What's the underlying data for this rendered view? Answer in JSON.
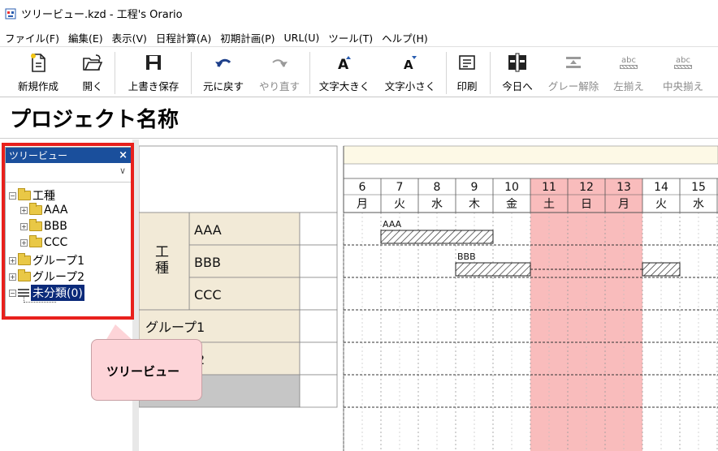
{
  "window": {
    "title": "ツリービュー.kzd - 工程's Orario"
  },
  "menu": [
    "ファイル(F)",
    "編集(E)",
    "表示(V)",
    "日程計算(A)",
    "初期計画(P)",
    "URL(U)",
    "ツール(T)",
    "ヘルプ(H)"
  ],
  "toolbar": {
    "new": "新規作成",
    "open": "開く",
    "save": "上書き保存",
    "undo": "元に戻す",
    "redo": "やり直す",
    "font_up": "文字大きく",
    "font_down": "文字小さく",
    "print": "印刷",
    "today": "今日へ",
    "gray_clear": "グレー解除",
    "align_left": "左揃え",
    "align_center": "中央揃え",
    "align_sample": "abc"
  },
  "project": {
    "title": "プロジェクト名称"
  },
  "tree": {
    "header": "ツリービュー",
    "close": "×",
    "items": [
      {
        "label": "工種",
        "level": 0,
        "expander": "⊟"
      },
      {
        "label": "AAA",
        "level": 1,
        "expander": "⊞"
      },
      {
        "label": "BBB",
        "level": 1,
        "expander": "⊞"
      },
      {
        "label": "CCC",
        "level": 1,
        "expander": "⊞"
      },
      {
        "label": "グループ1",
        "level": 0,
        "expander": "⊞"
      },
      {
        "label": "グループ2",
        "level": 0,
        "expander": "⊞"
      },
      {
        "label": "未分類(0)",
        "level": 0,
        "expander": "⊟",
        "selected": true
      }
    ]
  },
  "callout": {
    "text": "ツリービュー"
  },
  "grid": {
    "days": [
      {
        "num": "6",
        "wd": "月",
        "holiday": false
      },
      {
        "num": "7",
        "wd": "火",
        "holiday": false
      },
      {
        "num": "8",
        "wd": "水",
        "holiday": false
      },
      {
        "num": "9",
        "wd": "木",
        "holiday": false
      },
      {
        "num": "10",
        "wd": "金",
        "holiday": false
      },
      {
        "num": "11",
        "wd": "土",
        "holiday": true
      },
      {
        "num": "12",
        "wd": "日",
        "holiday": true
      },
      {
        "num": "13",
        "wd": "月",
        "holiday": true
      },
      {
        "num": "14",
        "wd": "火",
        "holiday": false
      },
      {
        "num": "15",
        "wd": "水",
        "holiday": false
      }
    ],
    "group_label": "工種",
    "rows": [
      "AAA",
      "BBB",
      "CCC"
    ],
    "extra_rows": [
      "グループ1",
      "グループ2"
    ],
    "bars": [
      {
        "label": "AAA",
        "row": 0,
        "start_day": "7",
        "end_day": "9"
      },
      {
        "label": "BBB",
        "row": 1,
        "start_day": "9",
        "end_day": "10"
      },
      {
        "label": "",
        "row": 1,
        "start_day": "14",
        "end_day": "14"
      }
    ],
    "holiday_color": "#f9bcbc",
    "accent": "#1a4f9c",
    "highlight": "#e8201c"
  }
}
